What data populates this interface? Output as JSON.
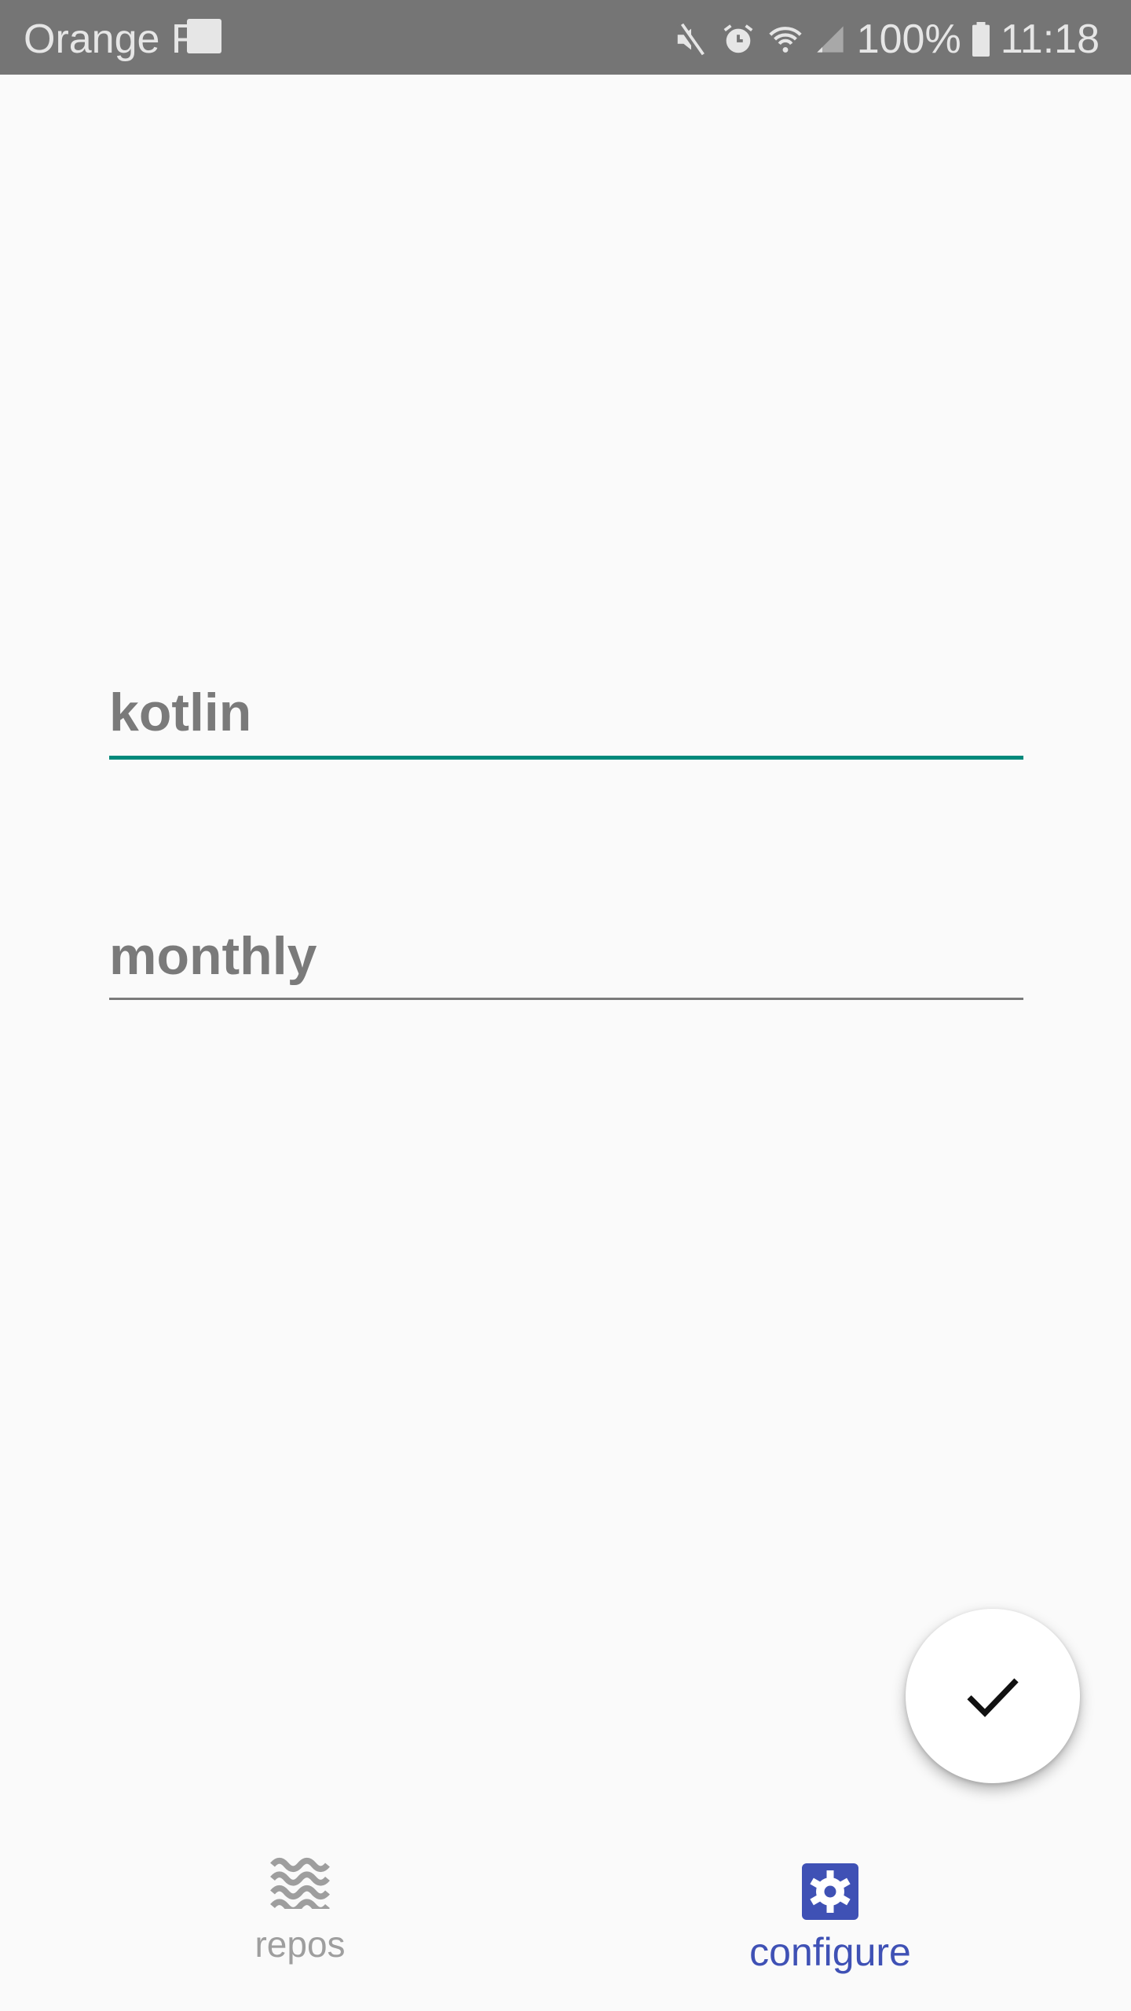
{
  "status_bar": {
    "carrier": "Orange F",
    "battery": "100%",
    "time": "11:18"
  },
  "form": {
    "query_value": "kotlin",
    "period_value": "monthly"
  },
  "fab": {
    "icon": "check-icon"
  },
  "bottom_nav": {
    "items": [
      {
        "label": "repos",
        "icon": "waves-icon",
        "active": false
      },
      {
        "label": "configure",
        "icon": "settings-icon",
        "active": true
      }
    ]
  },
  "colors": {
    "accent": "#3f51b5",
    "focus_line": "#00897b",
    "inactive": "#9e9e9e"
  }
}
